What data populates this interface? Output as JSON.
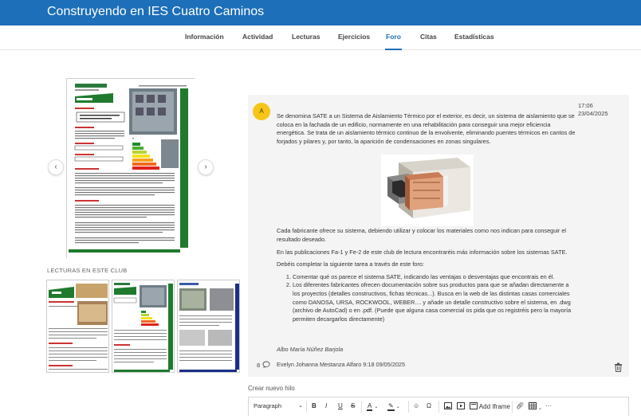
{
  "app": {
    "title": "Construyendo en IES Cuatro Caminos"
  },
  "tabs": [
    {
      "label": "Información"
    },
    {
      "label": "Actividad"
    },
    {
      "label": "Lecturas"
    },
    {
      "label": "Ejercicios"
    },
    {
      "label": "Foro"
    },
    {
      "label": "Citas"
    },
    {
      "label": "Estadísticas"
    }
  ],
  "active_tab": "Foro",
  "carousel": {
    "prev_icon": "chevron-left-icon",
    "next_icon": "chevron-right-icon"
  },
  "readings_section": {
    "label": "LECTURAS EN ESTE CLUB"
  },
  "post": {
    "avatar_letter": "A",
    "time": "17:06",
    "date": "23/04/2025",
    "paragraph1": "Se denomina SATE  a un Sistema de Aislamiento Térmico por el exterior, es decir, un sistema de aislamiento que se coloca en la fachada de un edificio, normamente en una rehabilitación para conseguir una mejor eficiencia energética. Se trata de un aislamiento térmico continuo de la envolvente, eliminando puentes térmicos en cantos de forjados y pilares y, por tanto, la aparición de condensaciones en zonas singulares.",
    "paragraph2": "Cada fabricante ofrece su sistema, debiendo utilizar y colocar los materiales como nos indican para conseguir el resultado deseado.",
    "paragraph3": "En las publicaciones Fa-1 y Fe-2 de este club de lectura encontraréis más información sobre los sistemas SATE.",
    "paragraph4": "Debéis completar la siguiente tarea a través de este foro:",
    "tasks": [
      "Comentar qué os parece el sistema SATE, indicando las ventajas o desventajas que encontrais en él.",
      "Los diferentes fabricantes ofrecen documentación sobre sus productos para que se añadan directamente a los proyectos (detalles constructivos, fichas técnicas...). Busca en la web de las distintas casas comerciales como DANOSA, URSA, ROCKWOOL, WEBER.... y añade un detalle constructivo sobre el sistema, en .dwg (archivo de AutoCad) o en .pdf.  (Puede que alguna casa comercial os pida que os registréis pero la mayoría permiten decargarlos directamente)"
    ],
    "signature": "Albo María Núñez Barjola",
    "reply_count": "8",
    "last_reply": "Evelyn Johanna Mestanza Alfaro 9:18 09/05/2025"
  },
  "new_thread": {
    "label": "Crear nuevo hilo"
  },
  "editor": {
    "format_select": "Paragraph",
    "bold": "B",
    "italic": "I",
    "underline": "U",
    "strike": "S",
    "add_iframe": "Add Iframe",
    "more": "···"
  },
  "colors": {
    "brand": "#1c6fb8",
    "avatar": "#f5c518",
    "card": "#f4f4f4"
  }
}
